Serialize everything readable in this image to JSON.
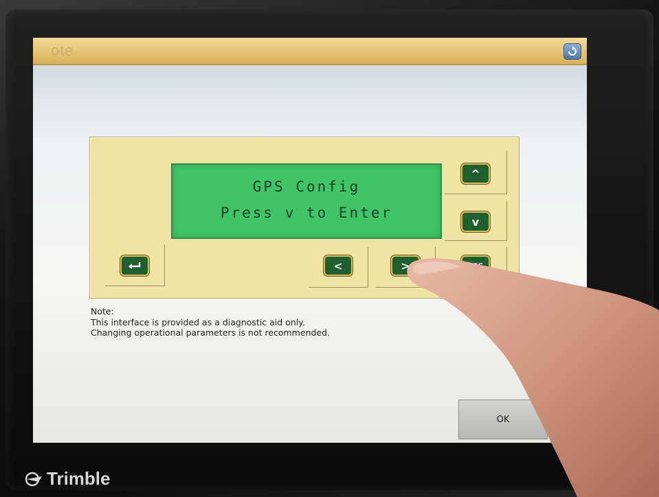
{
  "window": {
    "title": "ote",
    "icon": "refresh-icon"
  },
  "lcd": {
    "line1": "GPS Config",
    "line2": "Press v to Enter"
  },
  "keys": {
    "enter_icon": "enter-arrow-icon",
    "up_label": "^",
    "down_label": "v",
    "left_label": "<",
    "right_label": ">",
    "esc_label": "ESC"
  },
  "note": {
    "heading": "Note:",
    "line1": "This interface is provided as a diagnostic aid only.",
    "line2": "Changing operational parameters is not recommended."
  },
  "ok_button": {
    "label": "OK"
  },
  "device": {
    "brand": "Trimble",
    "brand_color": "#d8d8d8",
    "lcd_color": "#3fc466",
    "panel_color": "#f0e3a6",
    "key_color": "#1f5f2e"
  }
}
